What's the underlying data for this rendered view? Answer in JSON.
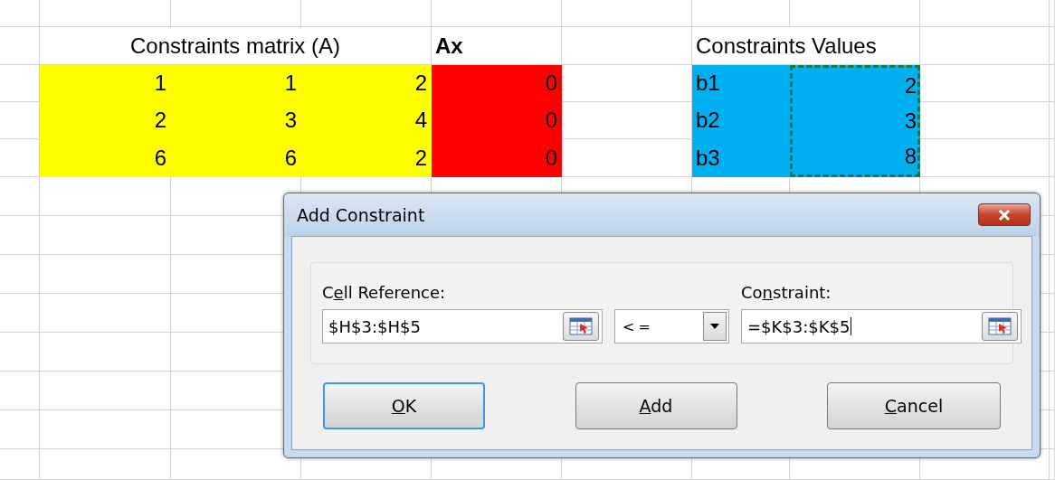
{
  "sheet": {
    "matrix": {
      "title": "Constraints matrix (A)",
      "color": "#ffff00",
      "rows": [
        [
          "1",
          "1",
          "2"
        ],
        [
          "2",
          "3",
          "4"
        ],
        [
          "6",
          "6",
          "2"
        ]
      ]
    },
    "ax": {
      "title": "Ax",
      "color": "#ff0000",
      "values": [
        "0",
        "0",
        "0"
      ]
    },
    "constraint_values": {
      "title": "Constraints Values",
      "color": "#00b0f0",
      "labels": [
        "b1",
        "b2",
        "b3"
      ],
      "values": [
        "2",
        "3",
        "8"
      ],
      "selected": true
    }
  },
  "dialog": {
    "title": "Add Constraint",
    "cell_reference": {
      "label": {
        "before": "C",
        "key": "e",
        "after": "ll Reference:"
      },
      "value": "$H$3:$H$5",
      "focused": false
    },
    "operator": {
      "value": "<="
    },
    "constraint": {
      "label": {
        "before": "Co",
        "key": "n",
        "after": "straint:"
      },
      "value": "=$K$3:$K$5",
      "focused": true
    },
    "buttons": [
      {
        "label": {
          "key": "O",
          "after": "K"
        },
        "focused": true
      },
      {
        "label": {
          "key": "A",
          "after": "dd"
        },
        "focused": false
      },
      {
        "label": {
          "key": "C",
          "after": "ancel"
        },
        "focused": false
      }
    ]
  }
}
